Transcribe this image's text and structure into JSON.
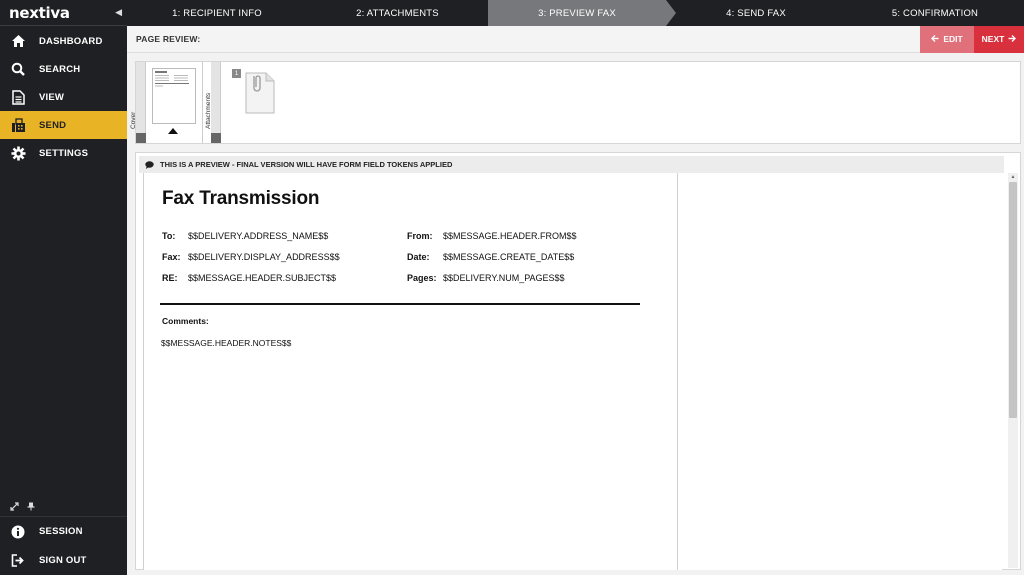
{
  "app": {
    "logo": "nextiva"
  },
  "sidebar": {
    "collapse_icon": "◀",
    "items": [
      {
        "label": "DASHBOARD",
        "icon": "home-icon",
        "active": false
      },
      {
        "label": "SEARCH",
        "icon": "search-icon",
        "active": false
      },
      {
        "label": "VIEW",
        "icon": "document-icon",
        "active": false
      },
      {
        "label": "SEND",
        "icon": "fax-icon",
        "active": true
      },
      {
        "label": "SETTINGS",
        "icon": "gear-icon",
        "active": false
      }
    ],
    "bottom": [
      {
        "label": "SESSION",
        "icon": "info-icon"
      },
      {
        "label": "SIGN OUT",
        "icon": "sign-out-icon"
      }
    ]
  },
  "steps": [
    {
      "label": "1: RECIPIENT INFO",
      "active": false
    },
    {
      "label": "2: ATTACHMENTS",
      "active": false
    },
    {
      "label": "3: PREVIEW FAX",
      "active": true
    },
    {
      "label": "4: SEND FAX",
      "active": false
    },
    {
      "label": "5: CONFIRMATION",
      "active": false
    }
  ],
  "toolbar": {
    "page_review_label": "PAGE REVIEW:",
    "edit_label": "EDIT",
    "next_label": "NEXT"
  },
  "thumbnails": {
    "cover_tab": "Cover",
    "attachments_tab": "Attachments",
    "attachment_count": "1"
  },
  "preview": {
    "notice": "THIS IS A PREVIEW - FINAL VERSION WILL HAVE FORM FIELD TOKENS APPLIED"
  },
  "fax": {
    "title": "Fax Transmission",
    "to_key": "To:",
    "to_value": "$$DELIVERY.ADDRESS_NAME$$",
    "from_key": "From:",
    "from_value": "$$MESSAGE.HEADER.FROM$$",
    "fax_key": "Fax:",
    "fax_value": "$$DELIVERY.DISPLAY_ADDRESS$$",
    "date_key": "Date:",
    "date_value": "$$MESSAGE.CREATE_DATE$$",
    "re_key": "RE:",
    "re_value": "$$MESSAGE.HEADER.SUBJECT$$",
    "pages_key": "Pages:",
    "pages_value": "$$DELIVERY.NUM_PAGES$$",
    "comments_label": "Comments:",
    "comments_value": "$$MESSAGE.HEADER.NOTES$$"
  },
  "colors": {
    "sidebar_bg": "#1f2023",
    "accent": "#e8b324",
    "edit_btn": "#e0707a",
    "next_btn": "#d9303e",
    "active_step": "#77787b"
  }
}
